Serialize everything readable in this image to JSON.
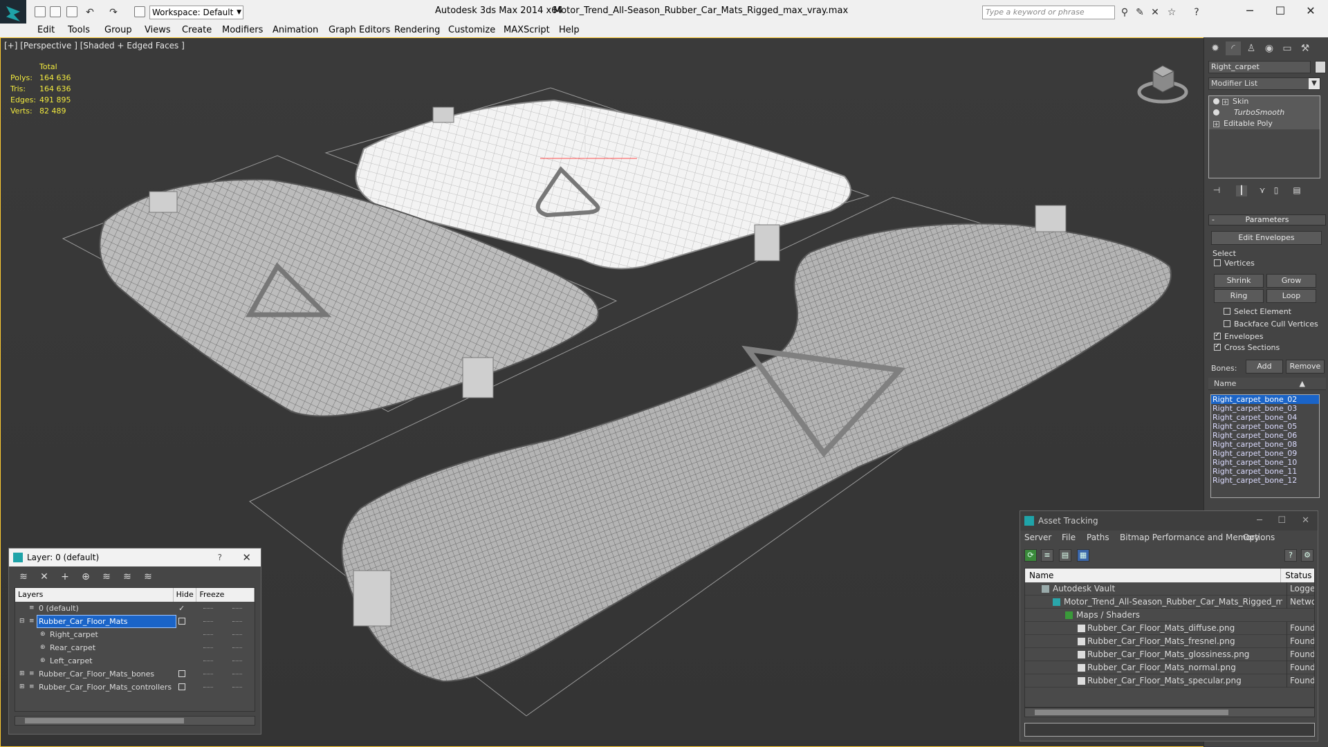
{
  "titlebar": {
    "workspace": "Workspace: Default",
    "app_title": "Autodesk 3ds Max  2014 x64",
    "file_name": "Motor_Trend_All-Season_Rubber_Car_Mats_Rigged_max_vray.max",
    "search_placeholder": "Type a keyword or phrase"
  },
  "menu": [
    "Edit",
    "Tools",
    "Group",
    "Views",
    "Create",
    "Modifiers",
    "Animation",
    "Graph Editors",
    "Rendering",
    "Customize",
    "MAXScript",
    "Help"
  ],
  "viewport": {
    "label": "[+] [Perspective ] [Shaded + Edged Faces ]",
    "stats": {
      "header": "Total",
      "rows": [
        {
          "label": "Polys:",
          "value": "164 636"
        },
        {
          "label": "Tris:",
          "value": "164 636"
        },
        {
          "label": "Edges:",
          "value": "491 895"
        },
        {
          "label": "Verts:",
          "value": "82 489"
        }
      ]
    }
  },
  "command_panel": {
    "object_name": "Right_carpet",
    "modifier_list": "Modifier List",
    "stack": [
      "Skin",
      "TurboSmooth",
      "Editable Poly"
    ],
    "parameters_title": "Parameters",
    "edit_envelopes": "Edit Envelopes",
    "select_title": "Select",
    "vertices": "Vertices",
    "shrink": "Shrink",
    "grow": "Grow",
    "ring": "Ring",
    "loop": "Loop",
    "select_element": "Select Element",
    "backface_cull": "Backface Cull Vertices",
    "envelopes": "Envelopes",
    "cross_sections": "Cross Sections",
    "bones_label": "Bones:",
    "add": "Add",
    "remove": "Remove",
    "name_header": "Name",
    "bones": [
      "Right_carpet_bone_02",
      "Right_carpet_bone_03",
      "Right_carpet_bone_04",
      "Right_carpet_bone_05",
      "Right_carpet_bone_06",
      "Right_carpet_bone_08",
      "Right_carpet_bone_09",
      "Right_carpet_bone_10",
      "Right_carpet_bone_11",
      "Right_carpet_bone_12"
    ]
  },
  "layer_window": {
    "title": "Layer: 0 (default)",
    "help": "?",
    "columns": [
      "Layers",
      "Hide",
      "Freeze"
    ],
    "rows": [
      {
        "name": "0 (default)",
        "indent": 0
      },
      {
        "name": "Rubber_Car_Floor_Mats",
        "indent": 0
      },
      {
        "name": "Right_carpet",
        "indent": 1
      },
      {
        "name": "Rear_carpet",
        "indent": 1
      },
      {
        "name": "Left_carpet",
        "indent": 1
      },
      {
        "name": "Rubber_Car_Floor_Mats_bones",
        "indent": 0
      },
      {
        "name": "Rubber_Car_Floor_Mats_controllers",
        "indent": 0
      }
    ]
  },
  "asset_window": {
    "title": "Asset Tracking",
    "menu": [
      "Server",
      "File",
      "Paths",
      "Bitmap Performance and Memory",
      "Options"
    ],
    "columns": [
      "Name",
      "Status"
    ],
    "rows": [
      {
        "name": "Autodesk Vault",
        "status": "Logged Out",
        "indent": 1
      },
      {
        "name": "Motor_Trend_All-Season_Rubber_Car_Mats_Rigged_max_vray.max",
        "status": "Network",
        "indent": 2
      },
      {
        "name": "Maps / Shaders",
        "status": "",
        "indent": 3
      },
      {
        "name": "Rubber_Car_Floor_Mats_diffuse.png",
        "status": "Found",
        "indent": 4
      },
      {
        "name": "Rubber_Car_Floor_Mats_fresnel.png",
        "status": "Found",
        "indent": 4
      },
      {
        "name": "Rubber_Car_Floor_Mats_glossiness.png",
        "status": "Found",
        "indent": 4
      },
      {
        "name": "Rubber_Car_Floor_Mats_normal.png",
        "status": "Found",
        "indent": 4
      },
      {
        "name": "Rubber_Car_Floor_Mats_specular.png",
        "status": "Found",
        "indent": 4
      }
    ]
  },
  "colors": {
    "accent": "#1a64c8",
    "stats_text": "#f1e93e",
    "viewport_bg": "#383838",
    "viewport_border": "#ffcc33"
  }
}
